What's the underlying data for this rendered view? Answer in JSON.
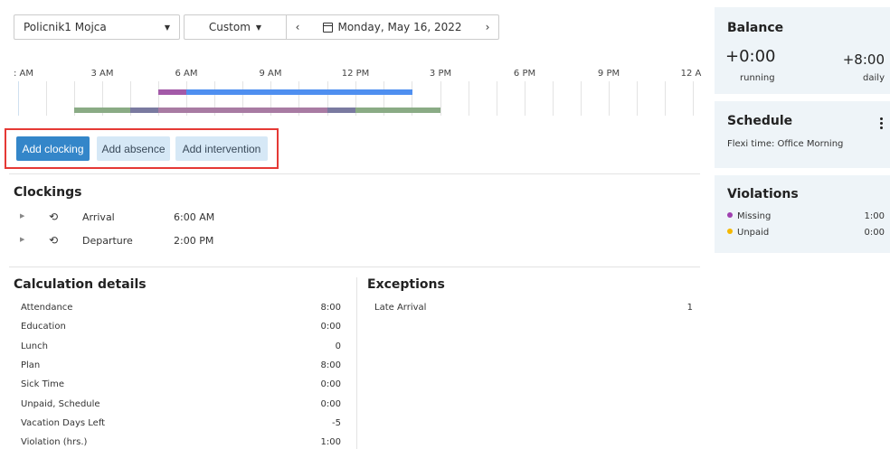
{
  "toolbar": {
    "employee": "Policnik1 Mojca",
    "range": "Custom",
    "prev": "‹",
    "next": "›",
    "date": "Monday, May 16, 2022"
  },
  "timeline": {
    "ticks": [
      ": AM",
      "3 AM",
      "6 AM",
      "9 AM",
      "12 PM",
      "3 PM",
      "6 PM",
      "9 PM",
      "12 A"
    ],
    "colors": {
      "purple": "#a35aa8",
      "blue": "#4f8ff0",
      "green": "#8aab85",
      "slate": "#7a7aa0",
      "mauve": "#a87ba3"
    }
  },
  "actions": {
    "add_clocking": "Add clocking",
    "add_absence": "Add absence",
    "add_intervention": "Add intervention"
  },
  "clockings": {
    "title": "Clockings",
    "items": [
      {
        "label": "Arrival",
        "time": "6:00 AM"
      },
      {
        "label": "Departure",
        "time": "2:00 PM"
      }
    ]
  },
  "calculation": {
    "title": "Calculation details",
    "rows": [
      {
        "label": "Attendance",
        "value": "8:00"
      },
      {
        "label": "Education",
        "value": "0:00"
      },
      {
        "label": "Lunch",
        "value": "0"
      },
      {
        "label": "Plan",
        "value": "8:00"
      },
      {
        "label": "Sick Time",
        "value": "0:00"
      },
      {
        "label": "Unpaid, Schedule",
        "value": "0:00"
      },
      {
        "label": "Vacation Days Left",
        "value": "-5"
      },
      {
        "label": "Violation (hrs.)",
        "value": "1:00"
      }
    ]
  },
  "exceptions": {
    "title": "Exceptions",
    "rows": [
      {
        "label": "Late Arrival",
        "value": "1"
      }
    ]
  },
  "balance": {
    "title": "Balance",
    "running_value": "+0:00",
    "running_label": "running",
    "daily_value": "+8:00",
    "daily_label": "daily"
  },
  "schedule": {
    "title": "Schedule",
    "text": "Flexi time: Office Morning"
  },
  "violations": {
    "title": "Violations",
    "items": [
      {
        "label": "Missing",
        "value": "1:00",
        "color": "#a040b0"
      },
      {
        "label": "Unpaid",
        "value": "0:00",
        "color": "#f5b800"
      }
    ]
  }
}
